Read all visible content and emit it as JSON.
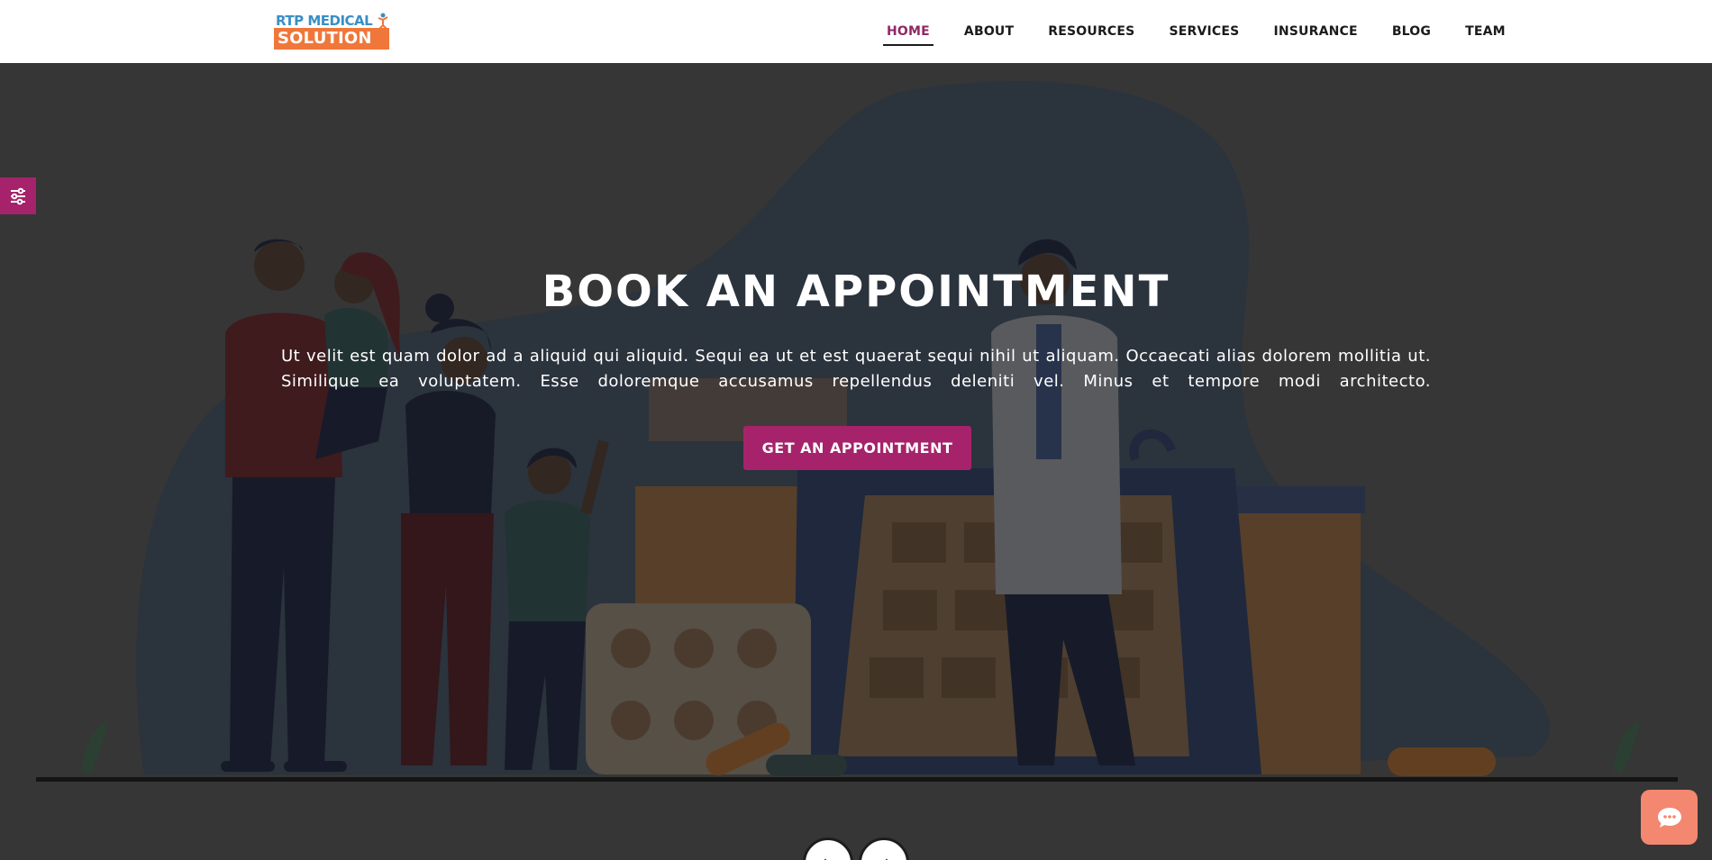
{
  "brand": {
    "logo_top": "RTP MEDICAL",
    "logo_bottom": "SOLUTION"
  },
  "nav": {
    "items": [
      {
        "label": "HOME",
        "active": true
      },
      {
        "label": "ABOUT",
        "active": false
      },
      {
        "label": "RESOURCES",
        "active": false
      },
      {
        "label": "SERVICES",
        "active": false
      },
      {
        "label": "INSURANCE",
        "active": false
      },
      {
        "label": "BLOG",
        "active": false
      },
      {
        "label": "TEAM",
        "active": false
      }
    ]
  },
  "hero": {
    "title": "BOOK AN APPOINTMENT",
    "text": "Ut velit est quam dolor ad a aliquid qui aliquid. Sequi ea ut et est quaerat sequi nihil ut aliquam. Occaecati alias dolorem mollitia ut. Similique ea voluptatem. Esse doloremque accusamus repellendus deleniti vel. Minus et tempore modi architecto.",
    "button_label": "GET AN APPOINTMENT"
  },
  "widgets": {
    "settings_icon": "sliders-icon",
    "chat_icon": "chat-bubble-icon",
    "slider_prev_icon": "arrow-left-icon",
    "slider_next_icon": "arrow-right-icon"
  },
  "colors": {
    "accent": "#a6236b",
    "nav_active": "#8e2a63",
    "chat": "#f48770",
    "logo_blue": "#3a8fc4",
    "logo_orange": "#f0773a"
  }
}
